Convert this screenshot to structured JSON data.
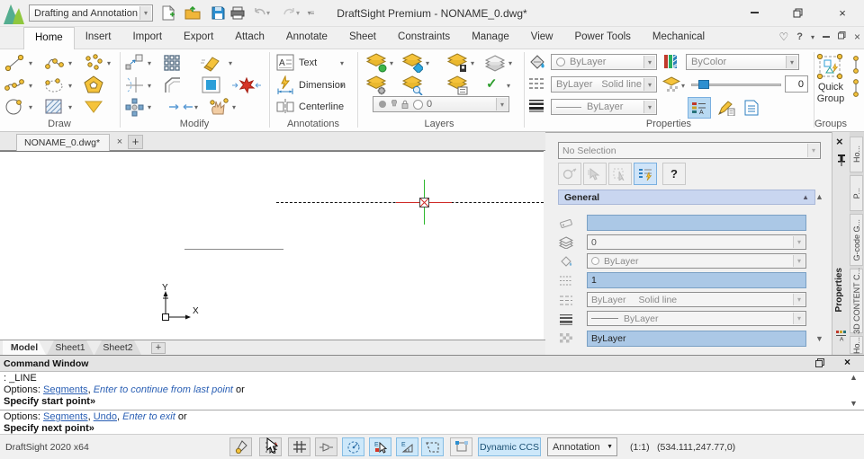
{
  "colors": {
    "accent_gold": "#f5c33b",
    "accent_blue": "#2d8fd0",
    "selection_field_blue": "#abc8e6",
    "active_toggle_blue": "#cde8fa",
    "link_blue": "#2a5fb4",
    "crosshair_green": "#2db82d",
    "crosshair_red": "#cf2a27"
  },
  "titlebar": {
    "workspace_selector": "Drafting and Annotation",
    "window_title": "DraftSight Premium - NONAME_0.dwg*"
  },
  "ribbon_tabs": [
    {
      "label": "Home"
    },
    {
      "label": "Insert"
    },
    {
      "label": "Import"
    },
    {
      "label": "Export"
    },
    {
      "label": "Attach"
    },
    {
      "label": "Annotate"
    },
    {
      "label": "Sheet"
    },
    {
      "label": "Constraints"
    },
    {
      "label": "Manage"
    },
    {
      "label": "View"
    },
    {
      "label": "Power Tools"
    },
    {
      "label": "Mechanical"
    }
  ],
  "ribbon": {
    "help_label": "?",
    "section_labels": {
      "draw": "Draw",
      "modify": "Modify",
      "annotations": "Annotations",
      "layers": "Layers",
      "properties": "Properties",
      "groups": "Groups"
    },
    "annotations": {
      "text": "Text",
      "dimension": "Dimension",
      "centerline": "Centerline"
    },
    "layers": {
      "active_layer": "0"
    },
    "properties": {
      "line_color": "ByLayer",
      "hatch_color": "ByColor",
      "line_style": "ByLayer",
      "line_style_type": "Solid line",
      "line_weight": "ByLayer",
      "transparency": "0"
    },
    "groups": {
      "quick_group": "Quick Group"
    }
  },
  "doc_bar": {
    "tab_label": "NONAME_0.dwg*",
    "add_label": "+"
  },
  "canvas": {
    "axis_x": "X",
    "axis_y": "Y"
  },
  "properties_panel": {
    "selection": "No Selection",
    "help_label": "?",
    "general_section": "General",
    "layer": "0",
    "line_color": "ByLayer",
    "line_scale": "1",
    "line_style": "ByLayer",
    "line_style_type": "Solid line",
    "line_weight": "ByLayer",
    "transparency": "ByLayer",
    "panel_tab": "Properties",
    "side_tabs": [
      {
        "label": "Ho..."
      },
      {
        "label": "P..."
      },
      {
        "label": "G-code G..."
      },
      {
        "label": "3D CONTENT C..."
      },
      {
        "label": "Ho..."
      }
    ]
  },
  "sheet_bar": {
    "tabs": [
      {
        "label": "Model"
      },
      {
        "label": "Sheet1"
      },
      {
        "label": "Sheet2"
      }
    ],
    "add_label": "+"
  },
  "command_window": {
    "title": "Command Window",
    "echo": ": _LINE",
    "opt1_prefix": "Options: ",
    "opt1_link": "Segments",
    "opt1_sep": ", ",
    "opt1_hint": "Enter to continue from last point",
    "opt1_suffix": " or",
    "prompt1": "Specify start point»",
    "opt2_prefix": "Options: ",
    "opt2_link1": "Segments",
    "opt2_sep1": ", ",
    "opt2_link2": "Undo",
    "opt2_sep2": ", ",
    "opt2_hint": "Enter to exit",
    "opt2_suffix": " or",
    "prompt2": "Specify next point»"
  },
  "statusbar": {
    "version": "DraftSight 2020 x64",
    "dynamic_ccs": "Dynamic CCS",
    "annotation_scale": "Annotation",
    "viewport_scale": "(1:1)",
    "coordinates": "(534.111,247.77,0)"
  }
}
